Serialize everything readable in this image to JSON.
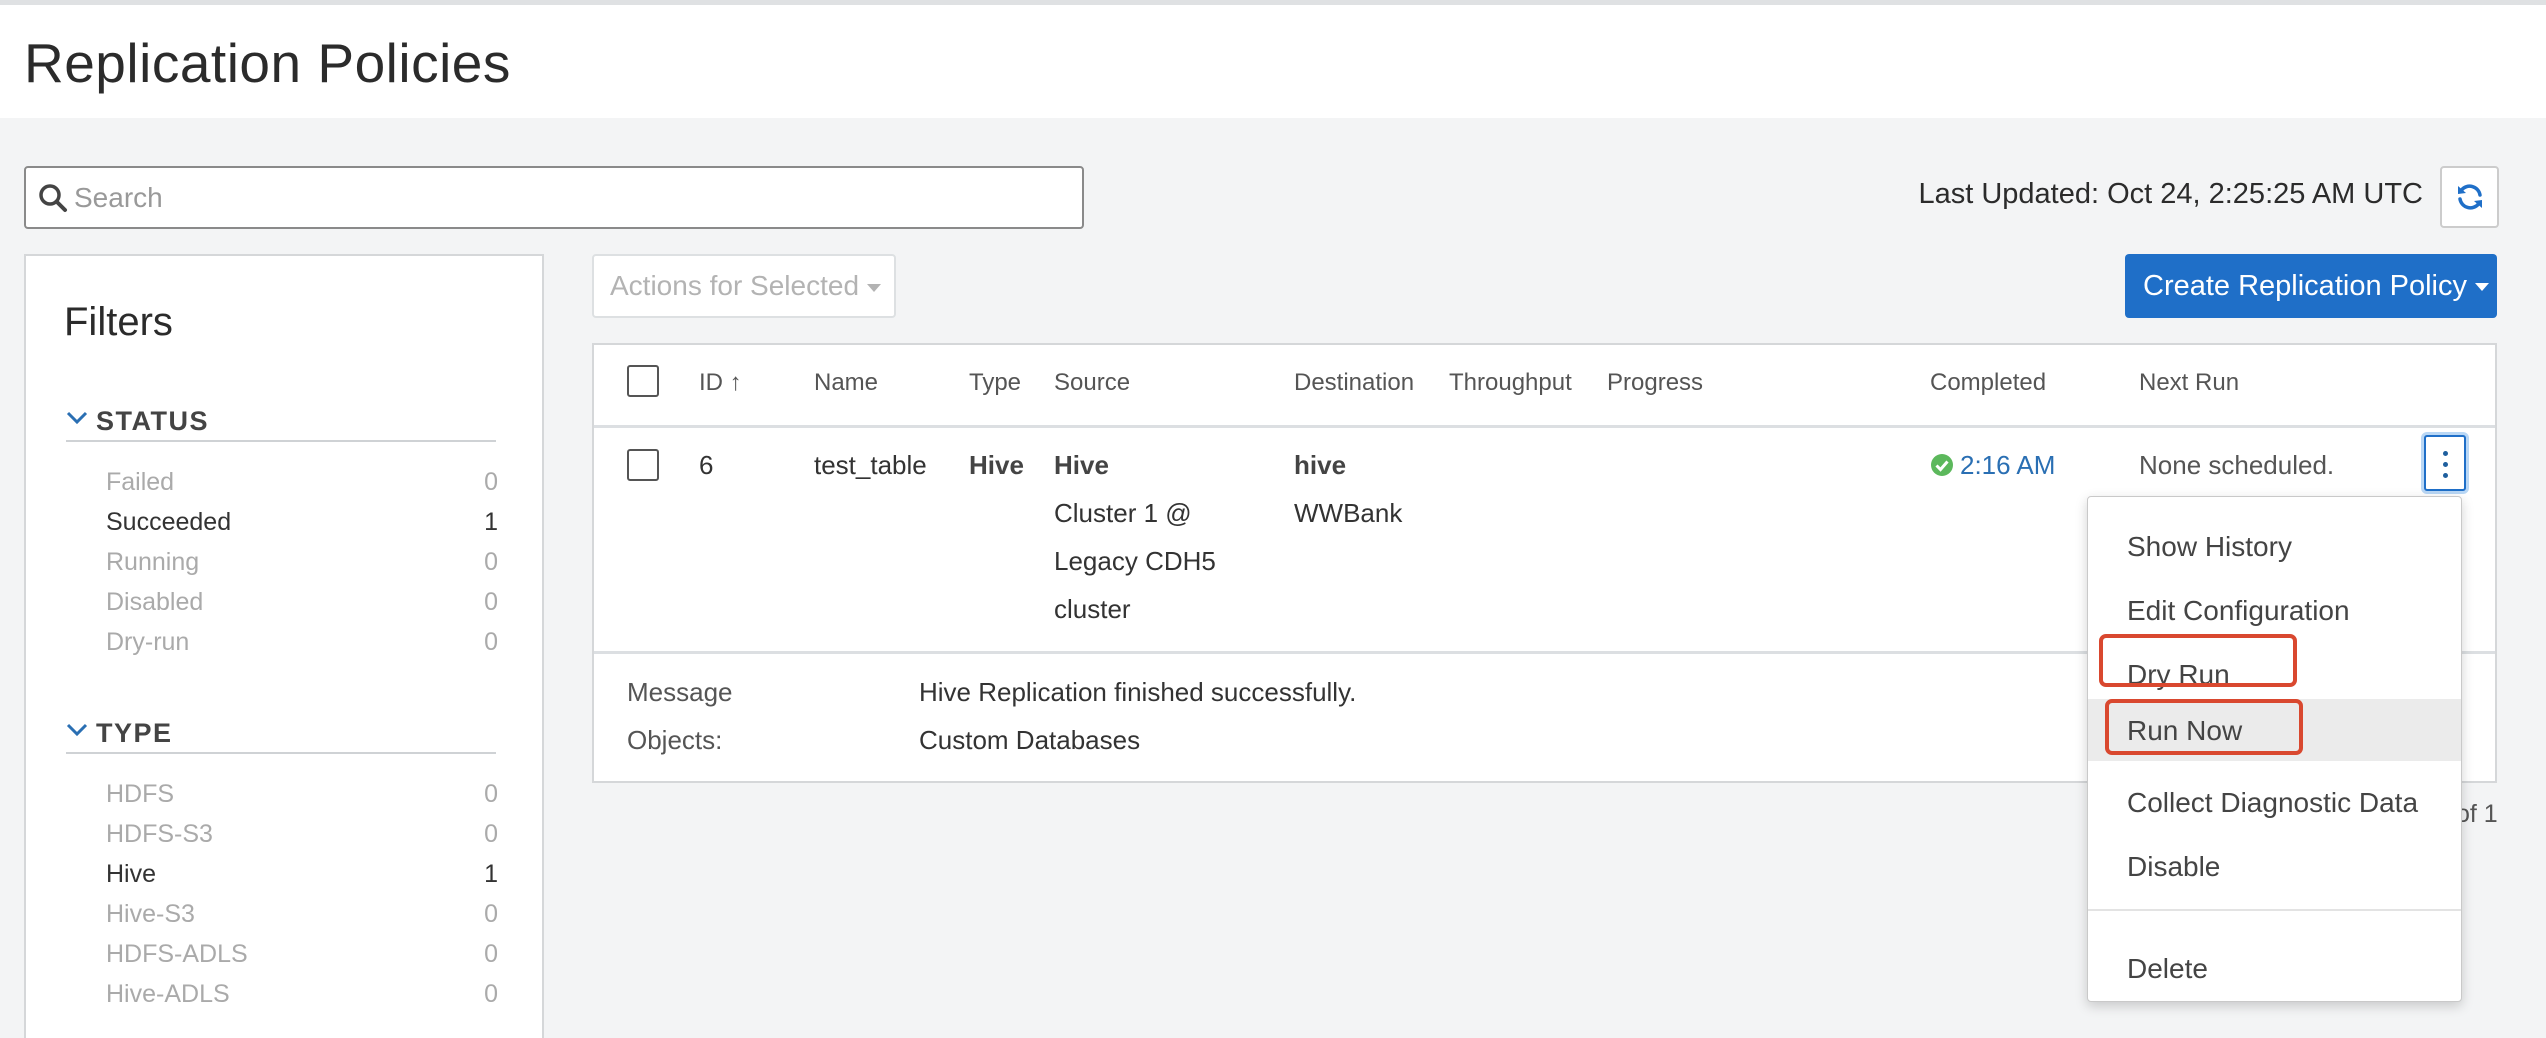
{
  "page": {
    "title": "Replication Policies"
  },
  "search": {
    "placeholder": "Search",
    "value": ""
  },
  "status_bar": {
    "last_updated": "Last Updated: Oct 24, 2:25:25 AM UTC"
  },
  "toolbar": {
    "actions_label": "Actions for Selected",
    "create_label": "Create Replication Policy"
  },
  "filters": {
    "title": "Filters",
    "status": {
      "heading": "STATUS",
      "items": [
        {
          "label": "Failed",
          "count": "0"
        },
        {
          "label": "Succeeded",
          "count": "1"
        },
        {
          "label": "Running",
          "count": "0"
        },
        {
          "label": "Disabled",
          "count": "0"
        },
        {
          "label": "Dry-run",
          "count": "0"
        }
      ]
    },
    "type": {
      "heading": "TYPE",
      "items": [
        {
          "label": "HDFS",
          "count": "0"
        },
        {
          "label": "HDFS-S3",
          "count": "0"
        },
        {
          "label": "Hive",
          "count": "1"
        },
        {
          "label": "Hive-S3",
          "count": "0"
        },
        {
          "label": "HDFS-ADLS",
          "count": "0"
        },
        {
          "label": "Hive-ADLS",
          "count": "0"
        }
      ]
    }
  },
  "table": {
    "columns": {
      "id": "ID",
      "id_sort": "↑",
      "name": "Name",
      "type": "Type",
      "source": "Source",
      "destination": "Destination",
      "throughput": "Throughput",
      "progress": "Progress",
      "completed": "Completed",
      "next_run": "Next Run"
    },
    "rows": [
      {
        "id": "6",
        "name": "test_table",
        "type": "Hive",
        "source_type": "Hive",
        "source_lines": [
          "Cluster 1 @",
          "Legacy CDH5",
          "cluster"
        ],
        "destination_type": "hive",
        "destination_name": "WWBank",
        "completed": "2:16 AM",
        "next_run": "None scheduled.",
        "message_label": "Message",
        "message_value": "Hive Replication finished successfully.",
        "objects_label": "Objects:",
        "objects_value": "Custom Databases"
      }
    ]
  },
  "pagination": {
    "text": "of 1"
  },
  "context_menu": {
    "items": [
      "Show History",
      "Edit Configuration",
      "Dry Run",
      "Run Now",
      "Collect Diagnostic Data",
      "Disable"
    ],
    "delete_label": "Delete",
    "active_item": "Run Now",
    "highlighted_items": [
      "Dry Run",
      "Run Now"
    ]
  },
  "colors": {
    "primary": "#1f6fc8",
    "success": "#5cb85c",
    "link": "#2a6fb3",
    "highlight_box": "#d9482f"
  },
  "icons": {
    "search": "search-icon",
    "refresh": "refresh-icon",
    "collapse": "chevron-down-icon",
    "success": "check-circle-icon",
    "row_actions": "kebab-icon"
  }
}
